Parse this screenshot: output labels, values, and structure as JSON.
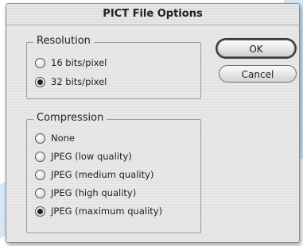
{
  "dialog": {
    "title": "PICT File Options",
    "resolution": {
      "legend": "Resolution",
      "options": [
        {
          "label": "16 bits/pixel",
          "selected": false
        },
        {
          "label": "32 bits/pixel",
          "selected": true
        }
      ]
    },
    "compression": {
      "legend": "Compression",
      "options": [
        {
          "label": "None",
          "selected": false
        },
        {
          "label": "JPEG  (low quality)",
          "selected": false
        },
        {
          "label": "JPEG  (medium quality)",
          "selected": false
        },
        {
          "label": "JPEG  (high quality)",
          "selected": false
        },
        {
          "label": "JPEG  (maximum quality)",
          "selected": true
        }
      ]
    },
    "buttons": {
      "ok": "OK",
      "cancel": "Cancel"
    }
  }
}
